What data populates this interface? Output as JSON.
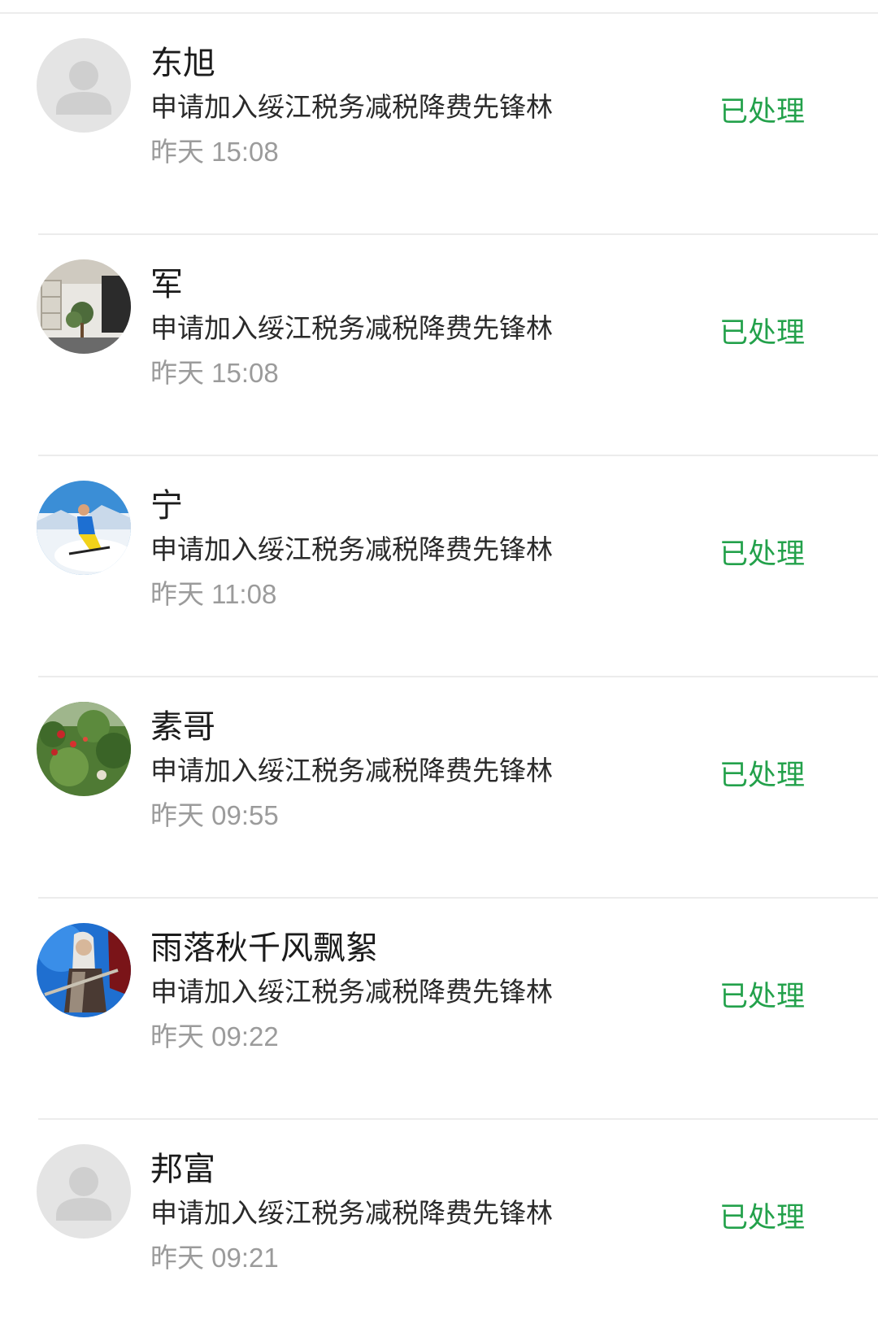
{
  "requests": [
    {
      "name": "东旭",
      "message": "申请加入绥江税务减税降费先锋林",
      "time": "昨天 15:08",
      "status": "已处理",
      "avatar": "default-avatar-icon"
    },
    {
      "name": "军",
      "message": "申请加入绥江税务减税降费先锋林",
      "time": "昨天 15:08",
      "status": "已处理",
      "avatar": "office-photo-avatar"
    },
    {
      "name": "宁",
      "message": "申请加入绥江税务减税降费先锋林",
      "time": "昨天 11:08",
      "status": "已处理",
      "avatar": "skier-photo-avatar"
    },
    {
      "name": "素哥",
      "message": "申请加入绥江税务减税降费先锋林",
      "time": "昨天 09:55",
      "status": "已处理",
      "avatar": "garden-photo-avatar"
    },
    {
      "name": "雨落秋千风飘絮",
      "message": "申请加入绥江税务减税降费先锋林",
      "time": "昨天 09:22",
      "status": "已处理",
      "avatar": "warrior-art-avatar"
    },
    {
      "name": "邦富",
      "message": "申请加入绥江税务减税降费先锋林",
      "time": "昨天 09:21",
      "status": "已处理",
      "avatar": "default-avatar-icon"
    }
  ],
  "colors": {
    "status_green": "#23a14b",
    "name_text": "#1b1b1b",
    "time_text": "#9b9b9b",
    "divider": "#ececec"
  }
}
